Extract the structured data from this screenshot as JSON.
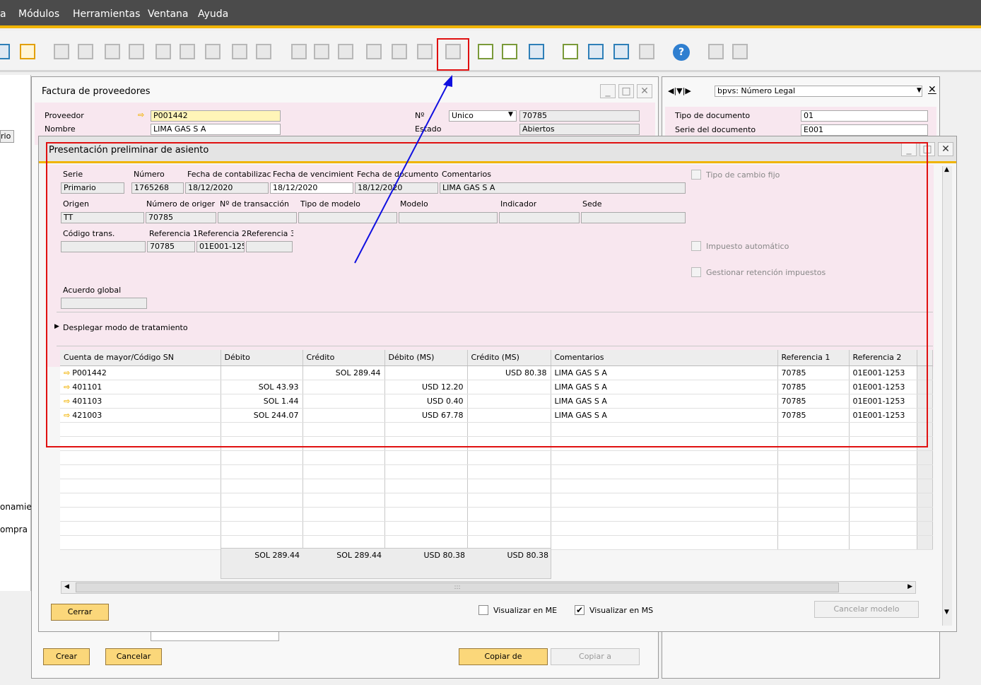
{
  "menu": {
    "items": [
      "a",
      "Módulos",
      "Herramientas",
      "Ventana",
      "Ayuda"
    ]
  },
  "toolbar": {
    "help_glyph": "?",
    "highlight_color": "#e01010"
  },
  "left_sidebar": {
    "tab": "rio",
    "items": [
      "onamier",
      "ompra"
    ]
  },
  "invoice": {
    "title": "Factura de proveedores",
    "proveedor_label": "Proveedor",
    "proveedor_value": "P001442",
    "nombre_label": "Nombre",
    "nombre_value": "LIMA GAS S A",
    "no_label": "Nº",
    "no_type": "Unico",
    "no_value": "70785",
    "estado_label": "Estado",
    "estado_value": "Abiertos",
    "buttons": {
      "crear": "Crear",
      "cancelar": "Cancelar",
      "copiar_de": "Copiar de",
      "copiar_a": "Copiar a"
    }
  },
  "side_panel": {
    "nav_title": "bpvs: Número Legal",
    "tipo_label": "Tipo de documento",
    "tipo_value": "01",
    "serie_label": "Serie del documento",
    "serie_value": "E001"
  },
  "preview": {
    "title": "Presentación preliminar de asiento",
    "headers1": {
      "serie": "Serie",
      "numero": "Número",
      "fecha_cont": "Fecha de contabilizac",
      "fecha_venc": "Fecha de vencimient",
      "fecha_doc": "Fecha de documento",
      "comentarios": "Comentarios"
    },
    "values1": {
      "serie": "Primario",
      "numero": "1765268",
      "fecha_cont": "18/12/2020",
      "fecha_venc": "18/12/2020",
      "fecha_doc": "18/12/2020",
      "comentarios": "LIMA GAS S A"
    },
    "headers2": {
      "origen": "Origen",
      "num_origen": "Número de origer",
      "num_trans": "Nº de transacción",
      "tipo_modelo": "Tipo de modelo",
      "modelo": "Modelo",
      "indicador": "Indicador",
      "sede": "Sede"
    },
    "values2": {
      "origen": "TT",
      "num_origen": "70785"
    },
    "headers3": {
      "codigo": "Código trans.",
      "ref1": "Referencia 1",
      "ref2": "Referencia 2",
      "ref3": "Referencia 3"
    },
    "values3": {
      "ref1": "70785",
      "ref2": "01E001-1253"
    },
    "acuerdo_label": "Acuerdo global",
    "desplegar_label": "Desplegar modo de tratamiento",
    "checks": {
      "tipo_cambio": "Tipo de cambio fijo",
      "impuesto": "Impuesto automático",
      "retencion": "Gestionar retención impuestos"
    },
    "table": {
      "columns": [
        "Cuenta de mayor/Código SN",
        "Débito",
        "Crédito",
        "Débito (MS)",
        "Crédito (MS)",
        "Comentarios",
        "Referencia 1",
        "Referencia 2"
      ],
      "rows": [
        {
          "cuenta": "P001442",
          "debito": "",
          "credito": "SOL 289.44",
          "debito_ms": "",
          "credito_ms": "USD 80.38",
          "comentarios": "LIMA GAS S A",
          "ref1": "70785",
          "ref2": "01E001-1253"
        },
        {
          "cuenta": "401101",
          "debito": "SOL 43.93",
          "credito": "",
          "debito_ms": "USD 12.20",
          "credito_ms": "",
          "comentarios": "LIMA GAS S A",
          "ref1": "70785",
          "ref2": "01E001-1253"
        },
        {
          "cuenta": "401103",
          "debito": "SOL 1.44",
          "credito": "",
          "debito_ms": "USD 0.40",
          "credito_ms": "",
          "comentarios": "LIMA GAS S A",
          "ref1": "70785",
          "ref2": "01E001-1253"
        },
        {
          "cuenta": "421003",
          "debito": "SOL 244.07",
          "credito": "",
          "debito_ms": "USD 67.78",
          "credito_ms": "",
          "comentarios": "LIMA GAS S A",
          "ref1": "70785",
          "ref2": "01E001-1253"
        }
      ],
      "empty_rows": 9,
      "totals": {
        "debito": "SOL 289.44",
        "credito": "SOL 289.44",
        "debito_ms": "USD 80.38",
        "credito_ms": "USD 80.38"
      }
    },
    "cerrar": "Cerrar",
    "visualizar_me": "Visualizar en ME",
    "visualizar_ms": "Visualizar en MS",
    "visualizar_ms_checked": true,
    "cancelar_modelo": "Cancelar modelo",
    "scroll_grip": ":::"
  },
  "colors": {
    "accent": "#f0b400",
    "highlight": "#e01010",
    "arrow": "#1010e0",
    "pink": "#f8e7ef"
  }
}
